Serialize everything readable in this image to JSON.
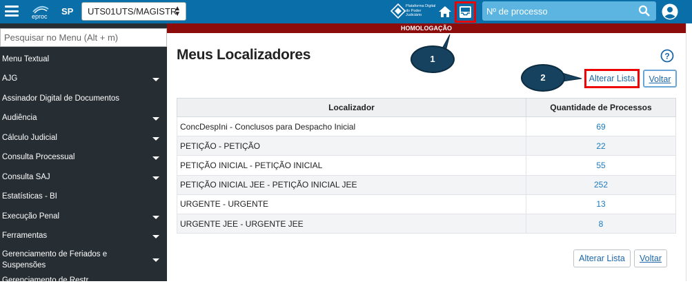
{
  "header": {
    "logo_text": "eproc",
    "state": "SP",
    "unit_selected": "UTS01UTS/MAGISTR",
    "platform_text": "Plataforma Digital do Poder Judiciário",
    "search_placeholder": "Nº de processo",
    "bg_color": "#0a6ea8"
  },
  "sidebar": {
    "search_placeholder": "Pesquisar no Menu (Alt + m)",
    "items": [
      {
        "label": "Menu Textual",
        "has_arrow": false
      },
      {
        "label": "AJG",
        "has_arrow": true
      },
      {
        "label": "Assinador Digital de Documentos",
        "has_arrow": false
      },
      {
        "label": "Audiência",
        "has_arrow": true
      },
      {
        "label": "Cálculo Judicial",
        "has_arrow": true
      },
      {
        "label": "Consulta Processual",
        "has_arrow": true
      },
      {
        "label": "Consulta SAJ",
        "has_arrow": true
      },
      {
        "label": "Estatísticas - BI",
        "has_arrow": false
      },
      {
        "label": "Execução Penal",
        "has_arrow": true
      },
      {
        "label": "Ferramentas",
        "has_arrow": true
      },
      {
        "label": "Gerenciamento de Feriados e Suspensões",
        "has_arrow": true
      },
      {
        "label": "Gerenciamento de Restr...",
        "has_arrow": false
      }
    ]
  },
  "banner": {
    "label": "HOMOLOGAÇÃO",
    "color": "#8c0b0b"
  },
  "main": {
    "title": "Meus Localizadores",
    "buttons": {
      "alterar": "Alterar Lista",
      "voltar": "Voltar"
    },
    "table": {
      "headers": [
        "Localizador",
        "Quantidade de Processos"
      ],
      "rows": [
        {
          "localizador": "ConcDespIni - Conclusos para Despacho Inicial",
          "quantidade": "69"
        },
        {
          "localizador": "PETIÇÃO - PETIÇÃO",
          "quantidade": "22"
        },
        {
          "localizador": "PETIÇÃO INICIAL - PETIÇÃO INICIAL",
          "quantidade": "55"
        },
        {
          "localizador": "PETIÇÃO INICIAL JEE - PETIÇÃO INICIAL JEE",
          "quantidade": "252"
        },
        {
          "localizador": "URGENTE - URGENTE",
          "quantidade": "13"
        },
        {
          "localizador": "URGENTE JEE - URGENTE JEE",
          "quantidade": "8"
        }
      ]
    }
  },
  "annotations": {
    "callout_1": "1",
    "callout_2": "2"
  }
}
